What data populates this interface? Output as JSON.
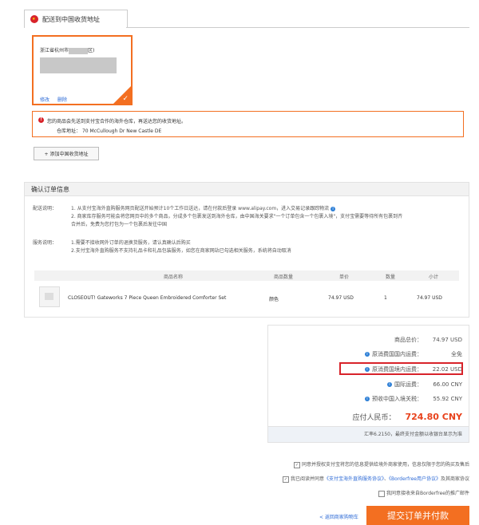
{
  "address_tab": {
    "label": "配送到中国收货地址"
  },
  "address_card": {
    "line1": "浙江省杭州市",
    "line1_suffix": "区)",
    "actions": [
      "修改",
      "删除"
    ]
  },
  "warning": {
    "text": "您的商品会先送到支付宝合作的海外仓库，再送达您的收货地址。",
    "warehouse_label": "仓库地址：",
    "warehouse_address": "70 McCullough Dr New Castle DE"
  },
  "add_address_button": "+ 添加中国收货地址",
  "confirm": {
    "title": "确认订单信息",
    "shipping_label": "配送说明：",
    "shipping_lines": [
      "1. 从支付宝海外直购服务网页配送开始预计10个工作日送达，请在付款后登录 www.alipay.com，进入交易记录跟踪物流",
      "2. 商家库存服务可能会将您网页中的多个商品，分成多个包裹发送到海外仓库，由中国海关要求\"一个订单包含一个包裹入境\"，支付宝需要等待所有包裹到齐",
      "合并后，免费为您打包为一个包裹后发往中国"
    ],
    "service_label": "服务说明：",
    "service_lines": [
      "1.需要不接收网外订单的退换货服务，请认真确认后购买",
      "2.支付宝海外直购服务不支持礼品卡和礼品包装服务，如您在商家网站已勾选相关服务，系统将自动取消"
    ],
    "columns": [
      "商品名称",
      "商品数量",
      "单价",
      "数量",
      "小计"
    ],
    "product": {
      "name": "CLOSEOUT! Gateworks 7 Piece Queen Embroidered Comforter Set",
      "attr": "颜色",
      "price": "74.97 USD",
      "qty": "1",
      "subtotal": "74.97 USD"
    }
  },
  "summary": {
    "rows": [
      {
        "label": "商品总价：",
        "value": "74.97 USD",
        "info": false
      },
      {
        "label": "原消费国国内运费：",
        "value": "全免",
        "info": true
      },
      {
        "label": "原消费国境内运费：",
        "value": "22.02 USD",
        "info": true
      },
      {
        "label": "国际运费：",
        "value": "66.00 CNY",
        "info": true
      },
      {
        "label": "预收中国入境关税：",
        "value": "55.92 CNY",
        "info": true
      }
    ],
    "total_label": "应付人民币：",
    "total_value": "724.80 CNY",
    "rate_text": "汇率6.2150，最终支付金额以收银台显示为准"
  },
  "agreements": {
    "line1": "同意并授权支付宝将您的信息提供给境外商家使用，信息仅限于您的购买及售后",
    "line2_prefix": "我已阅读并同意",
    "line2_link1": "《支付宝海外直购服务协议》",
    "line2_mid": "、",
    "line2_link2": "《Borderfree用户协议》",
    "line2_suffix": "及其商家协议",
    "line3": "我同意接收来自Borderfree的推广邮件"
  },
  "footer": {
    "back_link": "< 返回商家购物车",
    "submit_label": "提交订单并付款"
  },
  "colors": {
    "accent": "#f36f21",
    "highlight": "#d8232a",
    "link": "#2d6ad6",
    "total": "#e8421c"
  }
}
